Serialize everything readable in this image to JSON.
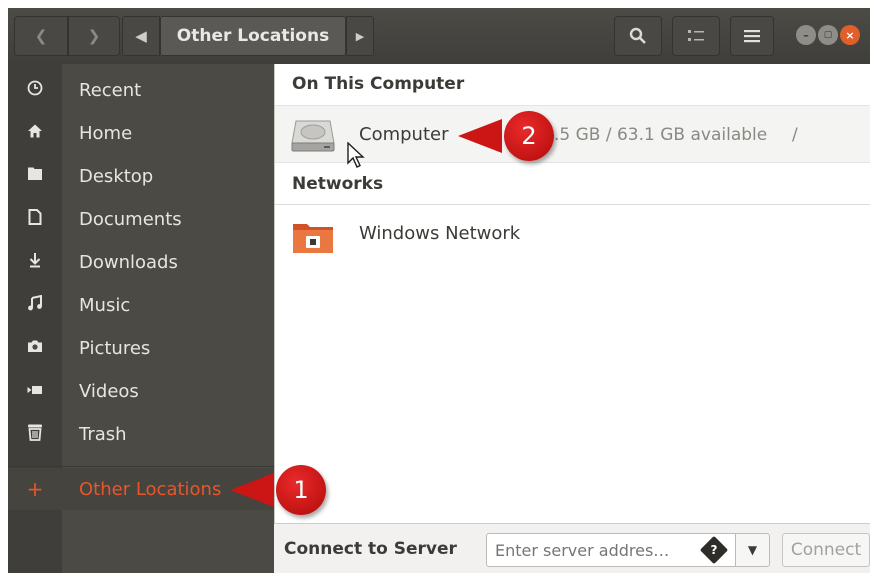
{
  "header": {
    "breadcrumb": "Other Locations",
    "icons": [
      "back-icon",
      "forward-icon",
      "left-arrow-icon",
      "right-arrow-icon",
      "search-icon",
      "view-list-icon",
      "menu-icon",
      "minimize-icon",
      "maximize-icon",
      "close-icon"
    ]
  },
  "sidebar": {
    "items": [
      {
        "label": "Recent",
        "icon": "clock-icon"
      },
      {
        "label": "Home",
        "icon": "home-icon"
      },
      {
        "label": "Desktop",
        "icon": "folder-icon"
      },
      {
        "label": "Documents",
        "icon": "document-icon"
      },
      {
        "label": "Downloads",
        "icon": "download-icon"
      },
      {
        "label": "Music",
        "icon": "music-icon"
      },
      {
        "label": "Pictures",
        "icon": "camera-icon"
      },
      {
        "label": "Videos",
        "icon": "video-icon"
      },
      {
        "label": "Trash",
        "icon": "trash-icon"
      }
    ],
    "other_locations": {
      "label": "Other Locations",
      "icon": "plus-icon"
    }
  },
  "main": {
    "on_this_computer": "On This Computer",
    "computer": {
      "label": "Computer",
      "info": ".5 GB / 63.1 GB available",
      "path": "/"
    },
    "networks": "Networks",
    "windows_network": {
      "label": "Windows Network"
    }
  },
  "bottom": {
    "connect_label": "Connect to Server",
    "server_placeholder": "Enter server addres…",
    "connect_button": "Connect"
  },
  "callouts": {
    "one": "1",
    "two": "2"
  },
  "colors": {
    "accent": "#e9562a",
    "callout": "#cc1515",
    "sidebar": "#4b4a45",
    "headerbar": "#45433f"
  }
}
